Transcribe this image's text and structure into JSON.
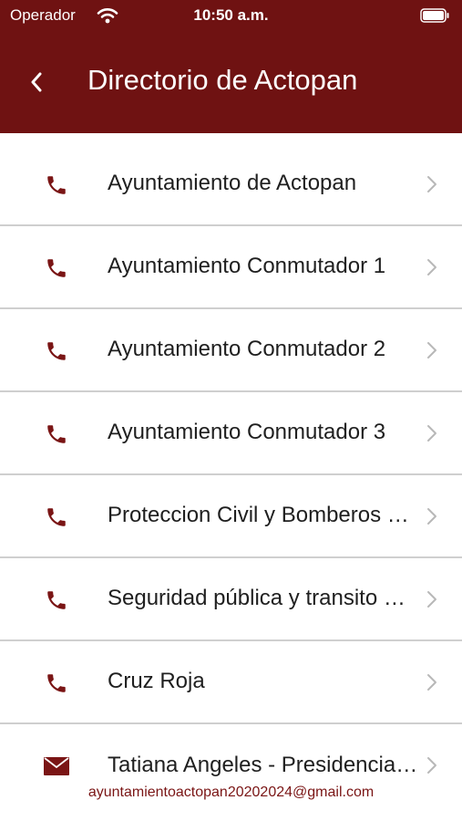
{
  "status_bar": {
    "carrier": "Operador",
    "time": "10:50 a.m.",
    "wifi_icon": "wifi-icon",
    "battery_icon": "battery-icon"
  },
  "nav": {
    "title": "Directorio de Actopan",
    "back_icon": "chevron-left-icon"
  },
  "colors": {
    "header_bg": "#6f1212",
    "accent": "#7a1515",
    "divider": "#cfcfcf",
    "chevron": "#b8b8b8"
  },
  "directory": {
    "items": [
      {
        "label": "Ayuntamiento de Actopan",
        "icon": "phone-icon"
      },
      {
        "label": "Ayuntamiento Conmutador 1",
        "icon": "phone-icon"
      },
      {
        "label": "Ayuntamiento Conmutador 2",
        "icon": "phone-icon"
      },
      {
        "label": "Ayuntamiento Conmutador 3",
        "icon": "phone-icon"
      },
      {
        "label": "Proteccion Civil y Bomberos …",
        "icon": "phone-icon"
      },
      {
        "label": "Seguridad pública y transito …",
        "icon": "phone-icon"
      },
      {
        "label": "Cruz Roja",
        "icon": "phone-icon"
      },
      {
        "label": "Tatiana Angeles - Presidencia…",
        "icon": "mail-icon",
        "subtitle": "ayuntamientoactopan20202024@gmail.com"
      }
    ]
  }
}
